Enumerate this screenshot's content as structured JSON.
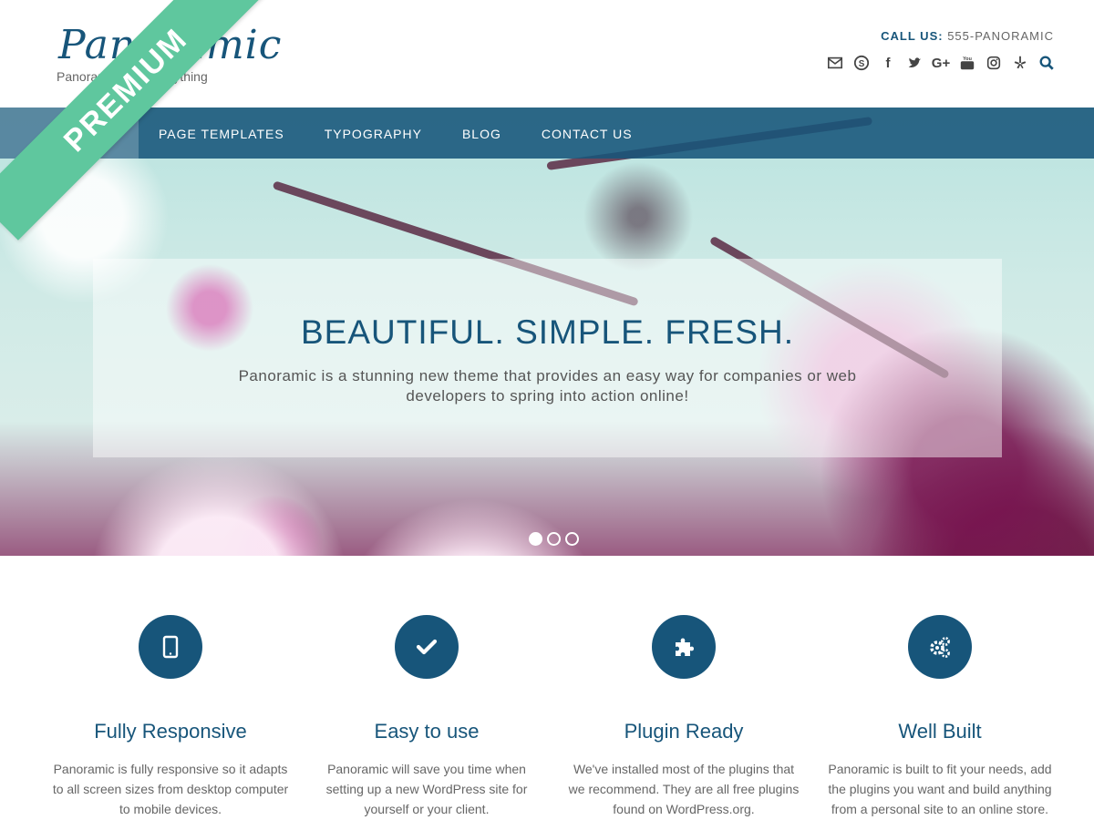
{
  "site": {
    "logo": "Panoramic",
    "tagline": "Panoramic - build anything",
    "call_label": "CALL US:",
    "call_number": "555-PANORAMIC",
    "ribbon": "PREMIUM"
  },
  "social": [
    {
      "name": "email-icon"
    },
    {
      "name": "skype-icon"
    },
    {
      "name": "facebook-icon",
      "glyph": "f"
    },
    {
      "name": "twitter-icon"
    },
    {
      "name": "google-plus-icon",
      "glyph": "G+"
    },
    {
      "name": "youtube-icon"
    },
    {
      "name": "instagram-icon"
    },
    {
      "name": "yelp-icon"
    },
    {
      "name": "search-icon"
    }
  ],
  "nav": {
    "items": [
      {
        "label": "HOME"
      },
      {
        "label": "PAGE TEMPLATES"
      },
      {
        "label": "TYPOGRAPHY"
      },
      {
        "label": "BLOG"
      },
      {
        "label": "CONTACT US"
      }
    ]
  },
  "slider": {
    "title": "BEAUTIFUL. SIMPLE. FRESH.",
    "text": "Panoramic is a stunning new theme that provides an easy way for companies or web developers to spring into action online!",
    "slide_count": 3,
    "active_slide": 1
  },
  "features": [
    {
      "icon": "tablet-icon",
      "title": "Fully Responsive",
      "text": "Panoramic is fully responsive so it adapts to all screen sizes from desktop computer to mobile devices."
    },
    {
      "icon": "checkmark-icon",
      "title": "Easy to use",
      "text": "Panoramic will save you time when setting up a new WordPress site for yourself or your client."
    },
    {
      "icon": "puzzle-icon",
      "title": "Plugin Ready",
      "text": "We've installed most of the plugins that we recommend. They are all free plugins found on WordPress.org."
    },
    {
      "icon": "gears-icon",
      "title": "Well Built",
      "text": "Panoramic is built to fit your needs, add the plugins you want and build anything from a personal site to an online store."
    }
  ],
  "colors": {
    "brand": "#17557a",
    "ribbon": "#5fc79e",
    "text": "#666666"
  }
}
